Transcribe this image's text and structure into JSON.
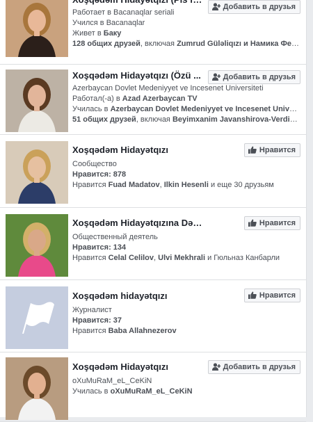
{
  "results": [
    {
      "name": "Xoşqədəm Hidayətqızı (Pis fa...",
      "button": "Добавить в друзья",
      "button_type": "add-friend",
      "lines": [
        {
          "text": "Работает в Bacanaqlar seriali"
        },
        {
          "text": "Учился в Bacanaqlar"
        },
        {
          "prefix": "Живет в ",
          "bold": "Баку"
        },
        {
          "bold": "128 общих друзей",
          "suffix": ", включая ",
          "bold2": "Zumrud Güləliqızı и Намика Ферь"
        }
      ]
    },
    {
      "name": "Xoşqədəm Hidayətqızı (Özü ...",
      "button": "Добавить в друзья",
      "button_type": "add-friend",
      "lines": [
        {
          "text": "Azerbaycan Dovlet Medeniyyet ve Incesenet Universiteti"
        },
        {
          "prefix": "Работал(-а) в ",
          "bold": "Azad Azerbaycan TV"
        },
        {
          "prefix": "Училась в ",
          "bold": "Azerbaycan Dovlet Medeniyyet ve Incesenet Unive..."
        },
        {
          "bold": "51 общих друзей",
          "suffix": ", включая ",
          "bold2": "Beyimxanim Javanshirova-Verdiy..."
        }
      ]
    },
    {
      "name": "Xoşqədəm Hidayətqızı",
      "button": "Нравится",
      "button_type": "like",
      "lines": [
        {
          "text": "Сообщество"
        },
        {
          "bold": "Нравится: 878"
        },
        {
          "prefix": "Нравится ",
          "bold": "Fuad Madatov",
          "suffix": ", ",
          "bold2": "Ilkin Hesenli",
          "suffix2": " и еще 30 друзьям"
        }
      ]
    },
    {
      "name": "Xoşqədəm Hidayətqızına Dəstək",
      "button": "Нравится",
      "button_type": "like",
      "lines": [
        {
          "text": "Общественный деятель"
        },
        {
          "bold": "Нравится: 134"
        },
        {
          "prefix": "Нравится ",
          "bold": "Celal Celilov",
          "suffix": ", ",
          "bold2": "Ulvi Mekhrali",
          "suffix2": " и Гюльназ Канбарли"
        }
      ]
    },
    {
      "name": "Xoşqədəm hidayətqızı",
      "button": "Нравится",
      "button_type": "like",
      "lines": [
        {
          "text": "Журналист"
        },
        {
          "bold": "Нравится: 37"
        },
        {
          "prefix": "Нравится ",
          "bold": "Baba Allahnezerov"
        }
      ]
    },
    {
      "name": "Xoşqədəm Hidayətqızı",
      "button": "Добавить в друзья",
      "button_type": "add-friend",
      "lines": [
        {
          "text": "oXuMuRaM_eL_CeKiN"
        },
        {
          "prefix": "Училась в ",
          "bold": "oXuMuRaM_eL_CeKiN"
        }
      ]
    }
  ]
}
